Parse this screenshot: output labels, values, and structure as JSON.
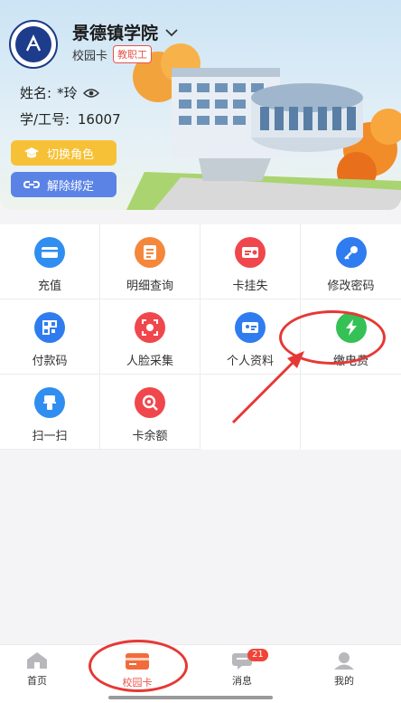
{
  "header": {
    "school_name": "景德镇学院",
    "card_type": "校园卡",
    "role_badge": "教职工",
    "name_label": "姓名:",
    "name_value": "*玲",
    "id_label": "学/工号:",
    "id_value": "16007",
    "switch_role_label": "切换角色",
    "unbind_label": "解除绑定"
  },
  "grid": {
    "items": [
      {
        "label": "充值",
        "icon": "recharge-card-icon",
        "color": "#2f8ef0"
      },
      {
        "label": "明细查询",
        "icon": "receipt-detail-icon",
        "color": "#f5873b"
      },
      {
        "label": "卡挂失",
        "icon": "card-lost-icon",
        "color": "#f0474d"
      },
      {
        "label": "修改密码",
        "icon": "key-icon",
        "color": "#2f7cf0"
      },
      {
        "label": "付款码",
        "icon": "qr-code-icon",
        "color": "#2f7cf0"
      },
      {
        "label": "人脸采集",
        "icon": "face-scan-icon",
        "color": "#f0474d"
      },
      {
        "label": "个人资料",
        "icon": "id-card-icon",
        "color": "#2f7cf0"
      },
      {
        "label": "缴电费",
        "icon": "lightning-icon",
        "color": "#35c156"
      },
      {
        "label": "扫一扫",
        "icon": "scanner-icon",
        "color": "#2f8ef0"
      },
      {
        "label": "卡余额",
        "icon": "balance-search-icon",
        "color": "#f0474d"
      }
    ]
  },
  "tabbar": {
    "tabs": [
      {
        "label": "首页",
        "icon": "home-icon"
      },
      {
        "label": "校园卡",
        "icon": "campus-card-icon"
      },
      {
        "label": "消息",
        "icon": "message-icon"
      },
      {
        "label": "我的",
        "icon": "profile-icon"
      }
    ],
    "message_badge": "21",
    "active_index": 1
  },
  "colors": {
    "accent_red": "#e8534a",
    "role_yellow": "#f7c137",
    "unbind_blue": "#5b83e6",
    "annotation_red": "#e53935"
  }
}
